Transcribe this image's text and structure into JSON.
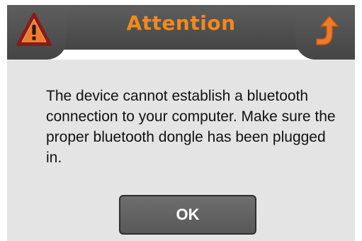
{
  "dialog": {
    "title": "Attention",
    "message": "The device cannot establish a bluetooth connection to your computer. Make sure the proper bluetooth dongle has been plugged in.",
    "ok_label": "OK",
    "left_icon": "warning-triangle-icon",
    "right_icon": "back-arrow-icon"
  },
  "colors": {
    "title_text": "#f28a1a",
    "title_bar": "#4f4f4f",
    "dialog_background": "#e4e4e4",
    "button_background": "#626262",
    "button_text": "#ffffff",
    "warning_fill": "#f07a2a",
    "warning_outline": "#8b1a1a"
  }
}
